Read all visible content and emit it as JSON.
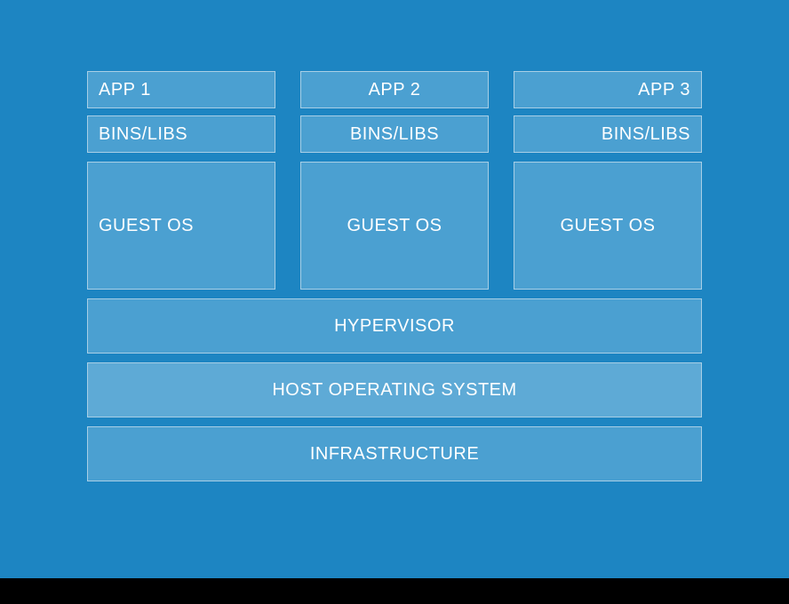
{
  "diagram": {
    "columns": [
      {
        "app": "APP 1",
        "bins": "BINS/LIBS",
        "guest": "GUEST OS",
        "align": "left"
      },
      {
        "app": "APP 2",
        "bins": "BINS/LIBS",
        "guest": "GUEST OS",
        "align": "center"
      },
      {
        "app": "APP 3",
        "bins": "BINS/LIBS",
        "guest": "GUEST OS",
        "align": "right"
      }
    ],
    "hypervisor": "HYPERVISOR",
    "host_os": "HOST OPERATING SYSTEM",
    "infrastructure": "INFRASTRUCTURE"
  },
  "colors": {
    "background": "#1d85c2",
    "box_fill": "#4ba0d1",
    "box_border": "#a8cfe6",
    "host_fill": "#5eaad6",
    "text": "#ffffff"
  }
}
